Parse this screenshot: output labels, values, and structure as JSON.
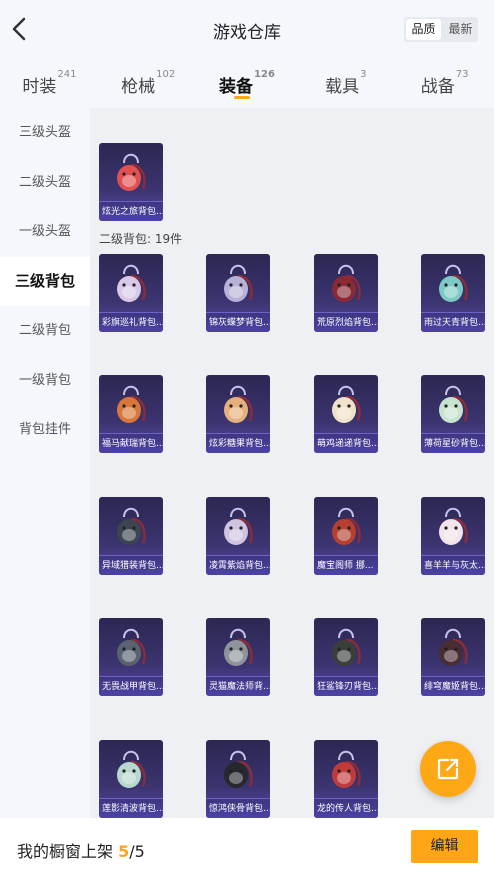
{
  "header": {
    "title": "游戏仓库",
    "sort_options": [
      "品质",
      "最新"
    ],
    "sort_active": 0
  },
  "tabs": [
    {
      "label": "时装",
      "count": "241"
    },
    {
      "label": "枪械",
      "count": "102"
    },
    {
      "label": "装备",
      "count": "126"
    },
    {
      "label": "载具",
      "count": "3"
    },
    {
      "label": "战备",
      "count": "73"
    }
  ],
  "active_tab": 2,
  "sidebar": {
    "items": [
      "三级头盔",
      "二级头盔",
      "一级头盔",
      "三级背包",
      "二级背包",
      "一级背包",
      "背包挂件"
    ],
    "active": 3
  },
  "top_item": {
    "name": "炫光之旅背包..."
  },
  "section": {
    "title": "二级背包: 19件"
  },
  "items": [
    {
      "name": "彩旗巡礼背包...",
      "icon": "backpack-icon",
      "color": "#d9c8e6"
    },
    {
      "name": "锦灰蝶梦背包...",
      "icon": "backpack-icon",
      "color": "#b8b2d8"
    },
    {
      "name": "荒原烈焰背包...",
      "icon": "backpack-icon",
      "color": "#8b2a35"
    },
    {
      "name": "雨过天青背包...",
      "icon": "backpack-icon",
      "color": "#7fc9c4"
    },
    {
      "name": "福马献瑞背包...",
      "icon": "backpack-icon",
      "color": "#d9773a"
    },
    {
      "name": "炫彩糖果背包...",
      "icon": "backpack-icon",
      "color": "#e6b07d"
    },
    {
      "name": "萌鸡递递背包...",
      "icon": "backpack-icon",
      "color": "#f0e2c8"
    },
    {
      "name": "薄荷星砂背包...",
      "icon": "backpack-icon",
      "color": "#c7e3d0"
    },
    {
      "name": "异域猎装背包...",
      "icon": "backpack-icon",
      "color": "#3d4550"
    },
    {
      "name": "凌霄紫焰背包...",
      "icon": "backpack-icon",
      "color": "#cfc3e0"
    },
    {
      "name": "魔宝阁师 挪...",
      "icon": "backpack-icon",
      "color": "#b5402f"
    },
    {
      "name": "喜羊羊与灰太...",
      "icon": "backpack-icon",
      "color": "#f1e4ea"
    },
    {
      "name": "无畏战甲背包...",
      "icon": "backpack-icon",
      "color": "#5a6370"
    },
    {
      "name": "灵猫魔法师背...",
      "icon": "backpack-icon",
      "color": "#8f949c"
    },
    {
      "name": "狂鲨锋刃背包...",
      "icon": "backpack-icon",
      "color": "#3a3f3c"
    },
    {
      "name": "绯穹魔姬背包...",
      "icon": "backpack-icon",
      "color": "#4a2c34"
    },
    {
      "name": "莲影清波背包...",
      "icon": "backpack-icon",
      "color": "#b8d8cf"
    },
    {
      "name": "惊鸿侠骨背包...",
      "icon": "backpack-icon",
      "color": "#26282d"
    },
    {
      "name": "龙的传人背包...",
      "icon": "backpack-icon",
      "color": "#c23b3b"
    }
  ],
  "footer": {
    "label": "我的橱窗上架",
    "count": "5",
    "total": "/5",
    "edit_label": "编辑"
  },
  "colors": {
    "accent": "#ffa617",
    "card": "#3b3470"
  }
}
